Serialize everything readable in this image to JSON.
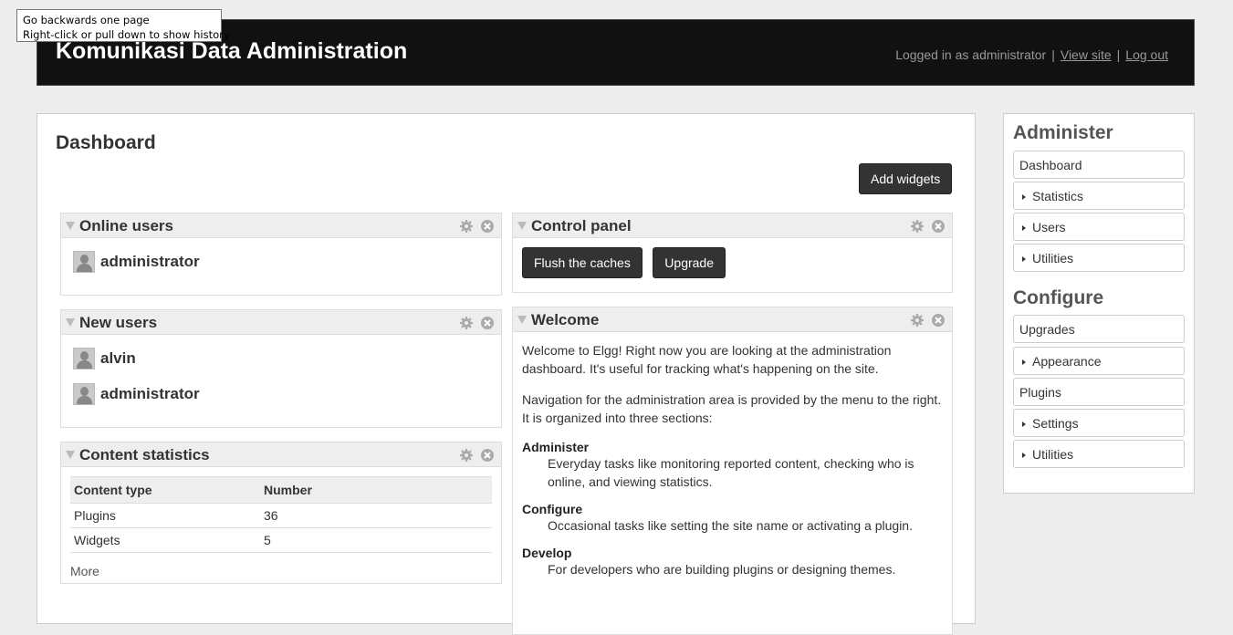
{
  "tooltip": {
    "line1": "Go backwards one page",
    "line2": "Right-click or pull down to show history"
  },
  "header": {
    "site_title": "Komunikasi Data Administration",
    "logged_in": "Logged in as administrator",
    "sep": "|",
    "view_site": "View site",
    "log_out": "Log out"
  },
  "main": {
    "page_title": "Dashboard",
    "add_widgets": "Add widgets"
  },
  "widgets": {
    "online_users": {
      "title": "Online users",
      "users": [
        "administrator"
      ]
    },
    "new_users": {
      "title": "New users",
      "users": [
        "alvin",
        "administrator"
      ]
    },
    "content_stats": {
      "title": "Content statistics",
      "col_type": "Content type",
      "col_number": "Number",
      "rows": [
        {
          "type": "Plugins",
          "number": "36"
        },
        {
          "type": "Widgets",
          "number": "5"
        }
      ],
      "more": "More"
    },
    "control_panel": {
      "title": "Control panel",
      "flush": "Flush the caches",
      "upgrade": "Upgrade"
    },
    "welcome": {
      "title": "Welcome",
      "p1": "Welcome to Elgg! Right now you are looking at the administration dashboard. It's useful for tracking what's happening on the site.",
      "p2": "Navigation for the administration area is provided by the menu to the right. It is organized into three sections:",
      "sections": [
        {
          "term": "Administer",
          "desc": "Everyday tasks like monitoring reported content, checking who is online, and viewing statistics."
        },
        {
          "term": "Configure",
          "desc": "Occasional tasks like setting the site name or activating a plugin."
        },
        {
          "term": "Develop",
          "desc": "For developers who are building plugins or designing themes."
        }
      ]
    }
  },
  "sidebar": {
    "administer_title": "Administer",
    "administer_items": [
      {
        "label": "Dashboard",
        "arrow": false
      },
      {
        "label": "Statistics",
        "arrow": true
      },
      {
        "label": "Users",
        "arrow": true
      },
      {
        "label": "Utilities",
        "arrow": true
      }
    ],
    "configure_title": "Configure",
    "configure_items": [
      {
        "label": "Upgrades",
        "arrow": false
      },
      {
        "label": "Appearance",
        "arrow": true
      },
      {
        "label": "Plugins",
        "arrow": false
      },
      {
        "label": "Settings",
        "arrow": true
      },
      {
        "label": "Utilities",
        "arrow": true
      }
    ]
  },
  "icons": {
    "widget_settings": "gear-icon",
    "widget_close": "close-icon",
    "widget_toggle": "triangle-down-icon",
    "avatar": "user-avatar-icon",
    "menu_arrow": "triangle-right-icon"
  }
}
